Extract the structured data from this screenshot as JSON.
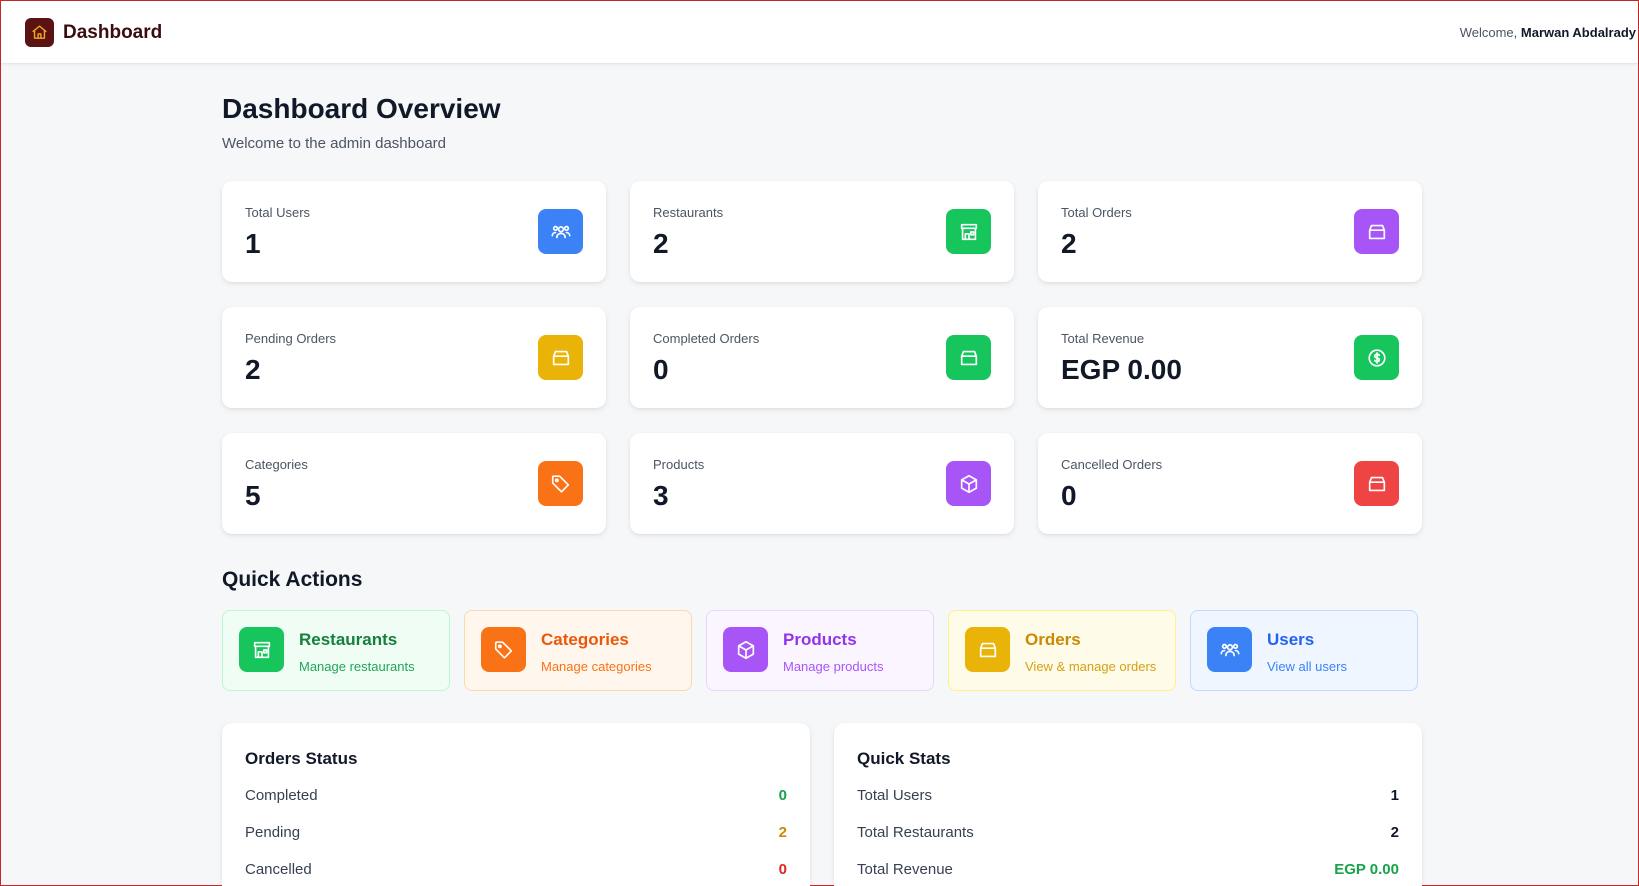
{
  "header": {
    "brand_title": "Dashboard",
    "brand_icon": "home-icon",
    "welcome_prefix": "Welcome,",
    "user_name": "Marwan Abdalrady"
  },
  "page": {
    "title": "Dashboard Overview",
    "subtitle": "Welcome to the admin dashboard"
  },
  "colors": {
    "blue": "#3b82f6",
    "green": "#16c55b",
    "purple": "#a855f7",
    "amber": "#eab308",
    "orange": "#f97316",
    "red": "#ef4444",
    "brand": "#5a1212"
  },
  "stats": [
    {
      "label": "Total Users",
      "value": "1",
      "icon": "users-icon",
      "color": "#3b82f6"
    },
    {
      "label": "Restaurants",
      "value": "2",
      "icon": "store-icon",
      "color": "#16c55b"
    },
    {
      "label": "Total Orders",
      "value": "2",
      "icon": "bag-icon",
      "color": "#a855f7"
    },
    {
      "label": "Pending Orders",
      "value": "2",
      "icon": "bag-icon",
      "color": "#eab308"
    },
    {
      "label": "Completed Orders",
      "value": "0",
      "icon": "bag-icon",
      "color": "#16c55b"
    },
    {
      "label": "Total Revenue",
      "value": "EGP 0.00",
      "icon": "dollar-icon",
      "color": "#16c55b"
    },
    {
      "label": "Categories",
      "value": "5",
      "icon": "tag-icon",
      "color": "#f97316"
    },
    {
      "label": "Products",
      "value": "3",
      "icon": "box-icon",
      "color": "#a855f7"
    },
    {
      "label": "Cancelled Orders",
      "value": "0",
      "icon": "bag-icon",
      "color": "#ef4444"
    }
  ],
  "quick_actions": {
    "title": "Quick Actions",
    "items": [
      {
        "title": "Restaurants",
        "desc": "Manage restaurants",
        "icon": "store-icon",
        "color": "#16c55b"
      },
      {
        "title": "Categories",
        "desc": "Manage categories",
        "icon": "tag-icon",
        "color": "#f97316"
      },
      {
        "title": "Products",
        "desc": "Manage products",
        "icon": "box-icon",
        "color": "#a855f7"
      },
      {
        "title": "Orders",
        "desc": "View & manage orders",
        "icon": "bag-icon",
        "color": "#eab308"
      },
      {
        "title": "Users",
        "desc": "View all users",
        "icon": "users-icon",
        "color": "#3b82f6"
      }
    ]
  },
  "orders_status": {
    "title": "Orders Status",
    "rows": [
      {
        "label": "Completed",
        "value": "0",
        "color": "#16a34a"
      },
      {
        "label": "Pending",
        "value": "2",
        "color": "#ca8a04"
      },
      {
        "label": "Cancelled",
        "value": "0",
        "color": "#dc2626"
      }
    ]
  },
  "quick_stats": {
    "title": "Quick Stats",
    "rows": [
      {
        "label": "Total Users",
        "value": "1",
        "color": "#111827"
      },
      {
        "label": "Total Restaurants",
        "value": "2",
        "color": "#111827"
      },
      {
        "label": "Total Revenue",
        "value": "EGP 0.00",
        "color": "#16a34a"
      }
    ]
  }
}
